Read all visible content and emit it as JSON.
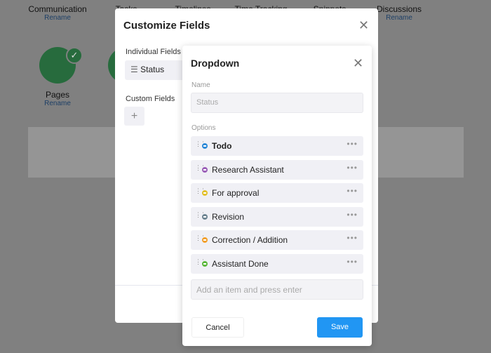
{
  "background": {
    "apps": [
      {
        "name": "Communication",
        "action": "Rename"
      },
      {
        "name": "Tasks",
        "action": ""
      },
      {
        "name": "Timelines",
        "action": ""
      },
      {
        "name": "Time Tracking",
        "action": ""
      },
      {
        "name": "Snippets",
        "action": ""
      },
      {
        "name": "Discussions",
        "action": "Rename"
      }
    ],
    "pages": {
      "name": "Pages",
      "action": "Rename"
    }
  },
  "customize": {
    "title": "Customize Fields",
    "individual_label": "Individual Fields",
    "status_item": "Status",
    "custom_label": "Custom Fields",
    "add_icon": "+"
  },
  "dropdown": {
    "title": "Dropdown",
    "name_label": "Name",
    "name_placeholder": "Status",
    "options_label": "Options",
    "options": [
      {
        "label": "Todo",
        "color": "#2d8ad8",
        "bold": true
      },
      {
        "label": "Research Assistant",
        "color": "#9b5fb8"
      },
      {
        "label": "For approval",
        "color": "#e2c12c"
      },
      {
        "label": "Revision",
        "color": "#6e8592"
      },
      {
        "label": "Correction / Addition",
        "color": "#f2a02c"
      },
      {
        "label": "Assistant Done",
        "color": "#5cb83c"
      }
    ],
    "add_placeholder": "Add an item and press enter",
    "cancel": "Cancel",
    "save": "Save"
  }
}
